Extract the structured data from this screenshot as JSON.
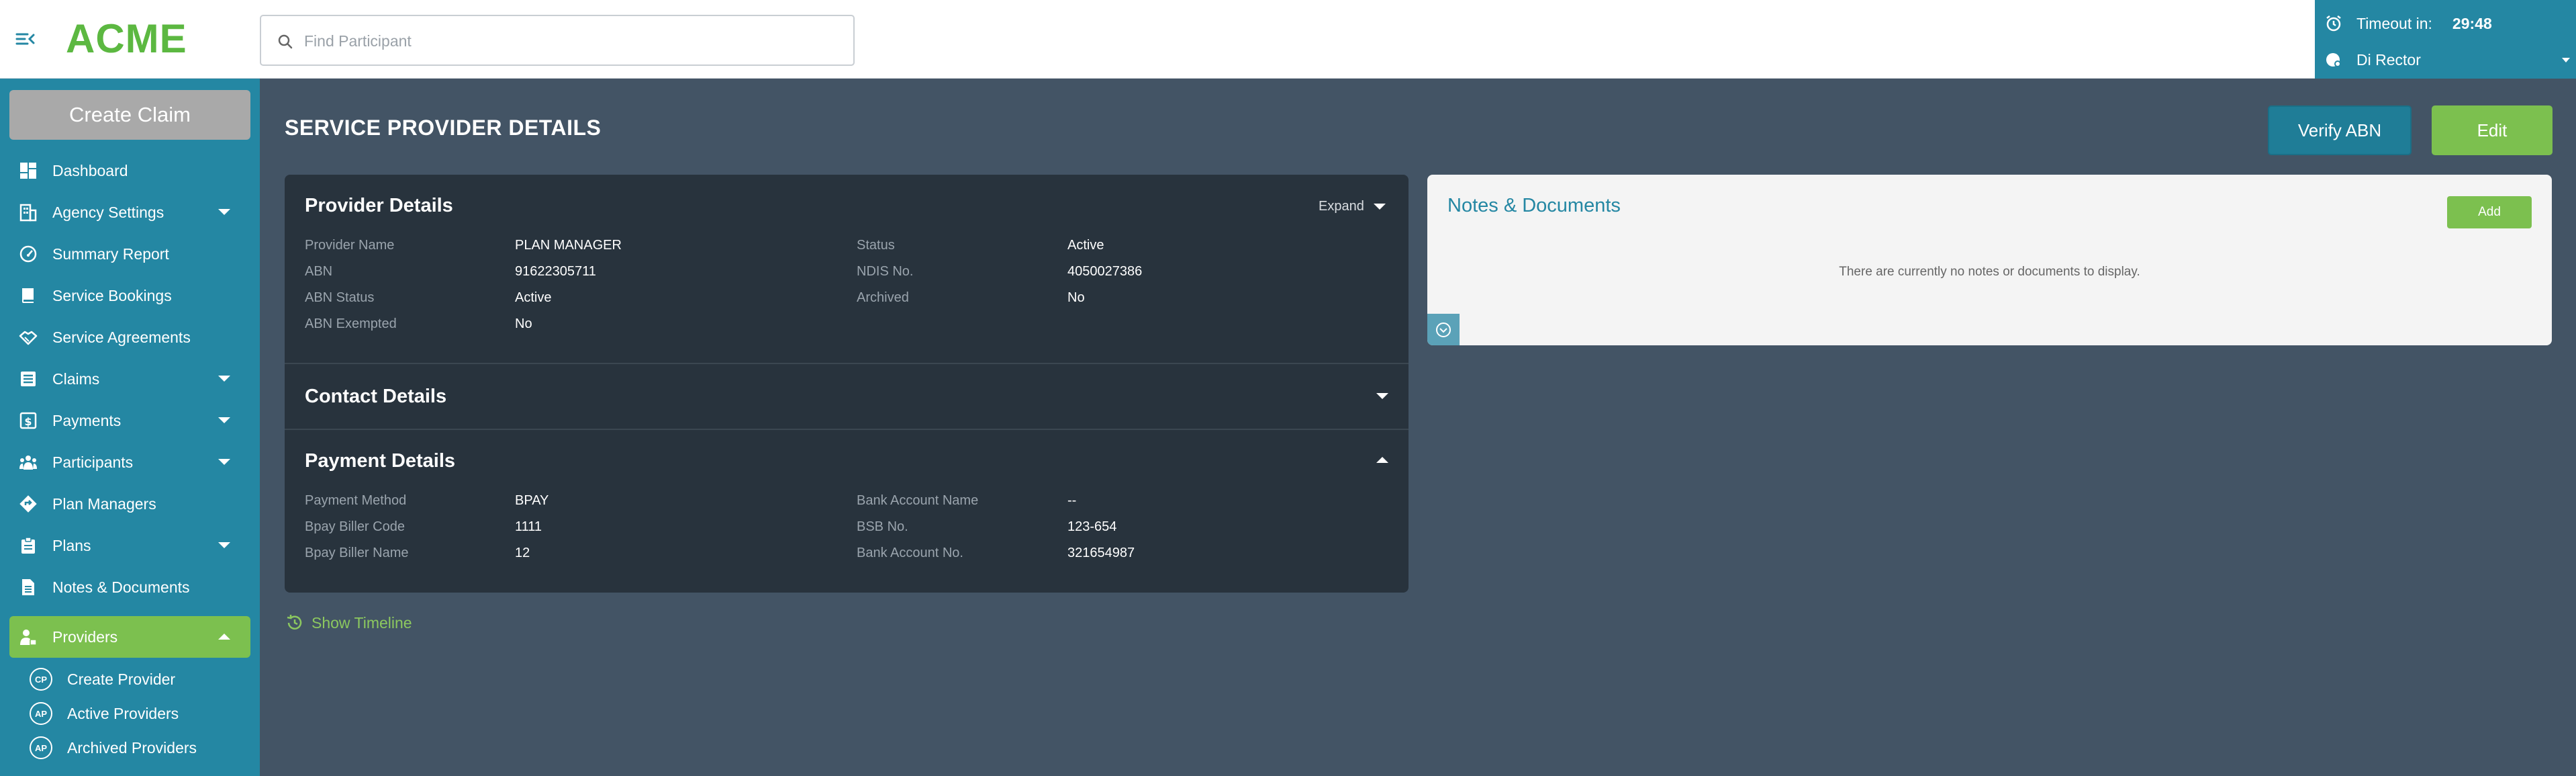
{
  "header": {
    "logo": "ACME",
    "search_placeholder": "Find Participant",
    "timeout_label": "Timeout in:",
    "timeout_value": "29:48",
    "user_name": "Di Rector"
  },
  "sidebar": {
    "create_claim": "Create Claim",
    "items": [
      {
        "label": "Dashboard",
        "icon": "dashboard-icon"
      },
      {
        "label": "Agency Settings",
        "icon": "building-icon"
      },
      {
        "label": "Summary Report",
        "icon": "gauge-icon"
      },
      {
        "label": "Service Bookings",
        "icon": "book-icon"
      },
      {
        "label": "Service Agreements",
        "icon": "handshake-icon"
      },
      {
        "label": "Claims",
        "icon": "list-icon"
      },
      {
        "label": "Payments",
        "icon": "dollar-icon"
      },
      {
        "label": "Participants",
        "icon": "people-icon"
      },
      {
        "label": "Plan Managers",
        "icon": "diamond-arrow-icon"
      },
      {
        "label": "Plans",
        "icon": "clipboard-icon"
      },
      {
        "label": "Notes & Documents",
        "icon": "document-icon"
      },
      {
        "label": "Providers",
        "icon": "provider-icon"
      }
    ],
    "sub_items": [
      {
        "badge": "CP",
        "label": "Create Provider"
      },
      {
        "badge": "AP",
        "label": "Active Providers"
      },
      {
        "badge": "AP",
        "label": "Archived Providers"
      }
    ]
  },
  "main": {
    "title": "SERVICE PROVIDER DETAILS",
    "verify_abn": "Verify ABN",
    "edit": "Edit",
    "provider_details": {
      "title": "Provider Details",
      "expand": "Expand",
      "fields": [
        {
          "label": "Provider Name",
          "value": "PLAN MANAGER"
        },
        {
          "label": "Status",
          "value": "Active"
        },
        {
          "label": "ABN",
          "value": "91622305711"
        },
        {
          "label": "NDIS No.",
          "value": "4050027386"
        },
        {
          "label": "ABN Status",
          "value": "Active"
        },
        {
          "label": "Archived",
          "value": "No"
        },
        {
          "label": "ABN Exempted",
          "value": "No"
        }
      ]
    },
    "contact_details": {
      "title": "Contact Details"
    },
    "payment_details": {
      "title": "Payment Details",
      "fields": [
        {
          "label": "Payment Method",
          "value": "BPAY"
        },
        {
          "label": "Bank Account Name",
          "value": "--"
        },
        {
          "label": "Bpay Biller Code",
          "value": "1111"
        },
        {
          "label": "BSB No.",
          "value": "123-654"
        },
        {
          "label": "Bpay Biller Name",
          "value": "12"
        },
        {
          "label": "Bank Account No.",
          "value": "321654987"
        }
      ]
    },
    "show_timeline": "Show Timeline",
    "notes": {
      "title": "Notes & Documents",
      "add": "Add",
      "empty": "There are currently no notes or documents to display."
    }
  },
  "colors": {
    "brand_green": "#5cb841",
    "sidebar_teal": "#2487a3",
    "page_bg": "#435465",
    "card_bg": "#28333d",
    "accent_green": "#7cc04f"
  }
}
